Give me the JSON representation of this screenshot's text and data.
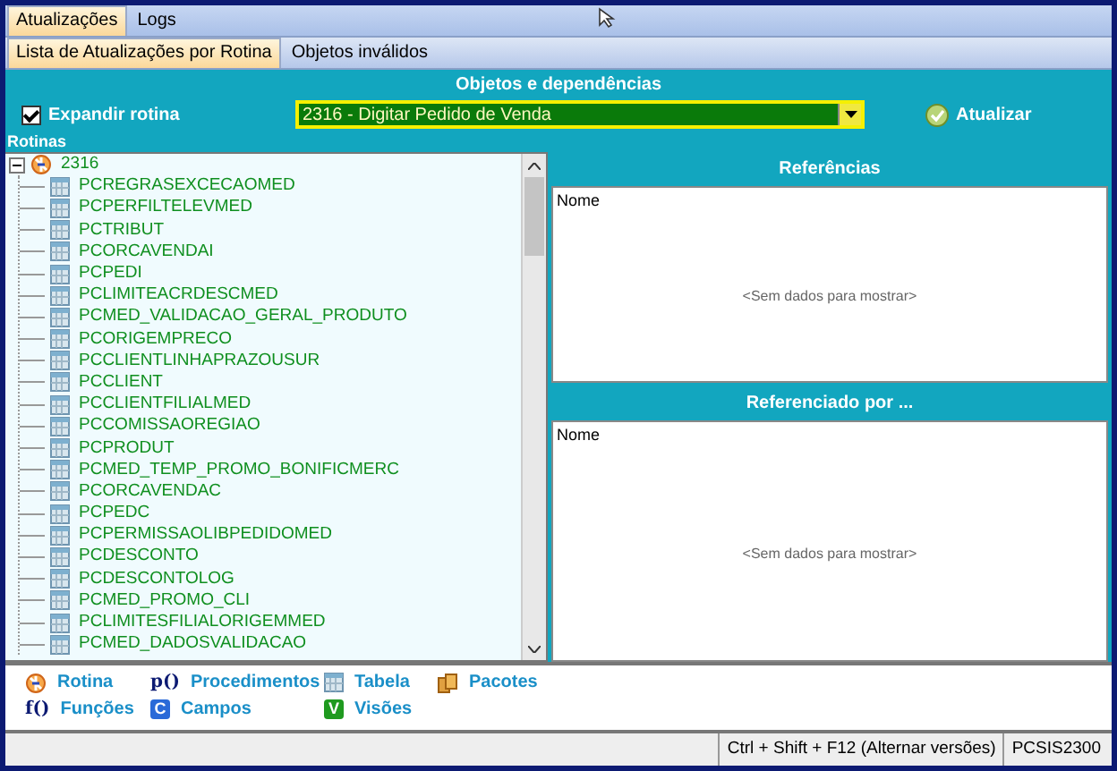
{
  "tabs": [
    {
      "label": "Atualizações",
      "selected": true
    },
    {
      "label": "Logs",
      "selected": false
    }
  ],
  "subtabs": [
    {
      "label": "Lista de Atualizações por Rotina",
      "selected": true
    },
    {
      "label": "Objetos inválidos",
      "selected": false
    }
  ],
  "section_title": "Objetos e dependências",
  "expand_checkbox": {
    "label": "Expandir rotina",
    "checked": true
  },
  "routine_select": {
    "value": "2316 - Digitar Pedido de Venda"
  },
  "refresh_button": "Atualizar",
  "tree_label": "Rotinas",
  "tree": [
    {
      "label": "2316",
      "kind": "rotina",
      "expanded": true,
      "children": [
        {
          "label": "PCREGRASEXCECAOMED",
          "kind": "tabela"
        },
        {
          "label": "PCPERFILTELEVMED",
          "kind": "tabela"
        },
        {
          "label": "PCTRIBUT",
          "kind": "tabela"
        },
        {
          "label": "PCORCAVENDAI",
          "kind": "tabela"
        },
        {
          "label": "PCPEDI",
          "kind": "tabela"
        },
        {
          "label": "PCLIMITEACRDESCMED",
          "kind": "tabela"
        },
        {
          "label": "PCMED_VALIDACAO_GERAL_PRODUTO",
          "kind": "tabela"
        },
        {
          "label": "PCORIGEMPRECO",
          "kind": "tabela"
        },
        {
          "label": "PCCLIENTLINHAPRAZOUSUR",
          "kind": "tabela"
        },
        {
          "label": "PCCLIENT",
          "kind": "tabela"
        },
        {
          "label": "PCCLIENTFILIALMED",
          "kind": "tabela"
        },
        {
          "label": "PCCOMISSAOREGIAO",
          "kind": "tabela"
        },
        {
          "label": "PCPRODUT",
          "kind": "tabela"
        },
        {
          "label": "PCMED_TEMP_PROMO_BONIFICMERC",
          "kind": "tabela"
        },
        {
          "label": "PCORCAVENDAC",
          "kind": "tabela"
        },
        {
          "label": "PCPEDC",
          "kind": "tabela"
        },
        {
          "label": "PCPERMISSAOLIBPEDIDOMED",
          "kind": "tabela"
        },
        {
          "label": "PCDESCONTO",
          "kind": "tabela"
        },
        {
          "label": "PCDESCONTOLOG",
          "kind": "tabela"
        },
        {
          "label": "PCMED_PROMO_CLI",
          "kind": "tabela"
        },
        {
          "label": "PCLIMITESFILIALORIGEMMED",
          "kind": "tabela"
        },
        {
          "label": "PCMED_DADOSVALIDACAO",
          "kind": "tabela"
        }
      ]
    }
  ],
  "panels": [
    {
      "title": "Referências",
      "column": "Nome",
      "empty_text": "<Sem dados para mostrar>"
    },
    {
      "title": "Referenciado por ...",
      "column": "Nome",
      "empty_text": "<Sem dados para mostrar>"
    }
  ],
  "legend": [
    {
      "kind": "rotina",
      "label": "Rotina"
    },
    {
      "kind": "procedimentos",
      "icon_text": "p()",
      "label": "Procedimentos"
    },
    {
      "kind": "tabela",
      "label": "Tabela"
    },
    {
      "kind": "pacotes",
      "label": "Pacotes"
    },
    {
      "kind": "funcoes",
      "icon_text": "f()",
      "label": "Funções"
    },
    {
      "kind": "campos",
      "icon_text": "C",
      "label": "Campos"
    },
    {
      "kind": "visoes",
      "icon_text": "V",
      "label": "Visões"
    }
  ],
  "status_bar": [
    "Ctrl + Shift + F12 (Alternar versões)",
    "PCSIS2300"
  ]
}
